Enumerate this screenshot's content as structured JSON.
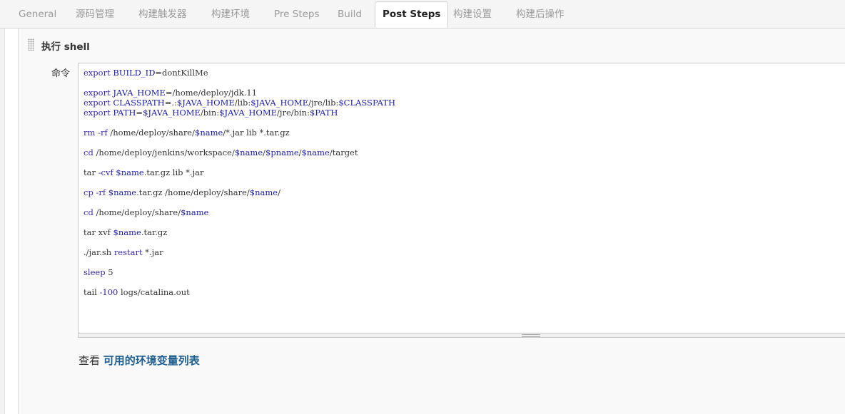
{
  "tabs": [
    {
      "label": "General"
    },
    {
      "label": "源码管理"
    },
    {
      "label": "构建触发器"
    },
    {
      "label": "构建环境"
    },
    {
      "label": "Pre Steps"
    },
    {
      "label": "Build"
    },
    {
      "label": "Post Steps",
      "active": true
    },
    {
      "label": "构建设置"
    },
    {
      "label": "构建后操作"
    }
  ],
  "section": {
    "title": "执行 shell",
    "command_label": "命令",
    "env_prefix": "查看",
    "env_link": "可用的环境变量列表"
  },
  "editor": {
    "value": "export BUILD_ID=dontKillMe\n\nexport JAVA_HOME=/home/deploy/jdk.11\nexport CLASSPATH=.:$JAVA_HOME/lib:$JAVA_HOME/jre/lib:$CLASSPATH\nexport PATH=$JAVA_HOME/bin:$JAVA_HOME/jre/bin:$PATH\n\nrm -rf /home/deploy/share/$name/*.jar lib *.tar.gz\n\ncd /home/deploy/jenkins/workspace/$name/$pname/$name/target\n\ntar -cvf $name.tar.gz lib *.jar\n\ncp -rf $name.tar.gz /home/deploy/share/$name/\n\ncd /home/deploy/share/$name\n\ntar xvf $name.tar.gz\n\n./jar.sh restart *.jar\n\nsleep 5\n\ntail -100 logs/catalina.out",
    "lines": [
      [
        {
          "t": "export",
          "c": "kw"
        },
        {
          "t": " "
        },
        {
          "t": "BUILD_ID",
          "c": "var"
        },
        {
          "t": "=dontKillMe"
        }
      ],
      [
        {
          "t": "export",
          "c": "kw"
        },
        {
          "t": " "
        },
        {
          "t": "JAVA_HOME",
          "c": "var"
        },
        {
          "t": "=/home/deploy/jdk.11"
        }
      ],
      [
        {
          "t": "export",
          "c": "kw"
        },
        {
          "t": " "
        },
        {
          "t": "CLASSPATH",
          "c": "var"
        },
        {
          "t": "=.:"
        },
        {
          "t": "$JAVA_HOME",
          "c": "var"
        },
        {
          "t": "/lib:"
        },
        {
          "t": "$JAVA_HOME",
          "c": "var"
        },
        {
          "t": "/jre/lib:"
        },
        {
          "t": "$CLASSPATH",
          "c": "var"
        }
      ],
      [
        {
          "t": "export",
          "c": "kw"
        },
        {
          "t": " "
        },
        {
          "t": "PATH",
          "c": "var"
        },
        {
          "t": "="
        },
        {
          "t": "$JAVA_HOME",
          "c": "var"
        },
        {
          "t": "/bin:"
        },
        {
          "t": "$JAVA_HOME",
          "c": "var"
        },
        {
          "t": "/jre/bin:"
        },
        {
          "t": "$PATH",
          "c": "var"
        }
      ],
      [
        {
          "t": "rm",
          "c": "kw"
        },
        {
          "t": " "
        },
        {
          "t": "-rf",
          "c": "kw"
        },
        {
          "t": " /home/deploy/share/"
        },
        {
          "t": "$name",
          "c": "var"
        },
        {
          "t": "/*.jar lib *.tar.gz"
        }
      ],
      [
        {
          "t": "cd",
          "c": "kw"
        },
        {
          "t": " /home/deploy/jenkins/workspace/"
        },
        {
          "t": "$name",
          "c": "var"
        },
        {
          "t": "/"
        },
        {
          "t": "$pname",
          "c": "var"
        },
        {
          "t": "/"
        },
        {
          "t": "$name",
          "c": "var"
        },
        {
          "t": "/target"
        }
      ],
      [
        {
          "t": "tar "
        },
        {
          "t": "-cvf",
          "c": "kw"
        },
        {
          "t": " "
        },
        {
          "t": "$name",
          "c": "var"
        },
        {
          "t": ".tar.gz lib *.jar"
        }
      ],
      [
        {
          "t": "cp",
          "c": "kw"
        },
        {
          "t": " "
        },
        {
          "t": "-rf",
          "c": "kw"
        },
        {
          "t": " "
        },
        {
          "t": "$name",
          "c": "var"
        },
        {
          "t": ".tar.gz /home/deploy/share/"
        },
        {
          "t": "$name",
          "c": "var"
        },
        {
          "t": "/"
        }
      ],
      [
        {
          "t": "cd",
          "c": "kw"
        },
        {
          "t": " /home/deploy/share/"
        },
        {
          "t": "$name",
          "c": "var"
        }
      ],
      [
        {
          "t": "tar xvf "
        },
        {
          "t": "$name",
          "c": "var"
        },
        {
          "t": ".tar.gz"
        }
      ],
      [
        {
          "t": "./jar.sh "
        },
        {
          "t": "restart",
          "c": "kw"
        },
        {
          "t": " *.jar"
        }
      ],
      [
        {
          "t": "sleep",
          "c": "kw"
        },
        {
          "t": " 5"
        }
      ],
      [
        {
          "t": "tail "
        },
        {
          "t": "-100",
          "c": "kw"
        },
        {
          "t": " logs/catalina.out"
        }
      ]
    ]
  },
  "colors": {
    "keyword": "#3a2bb0",
    "variable": "#1a1aa6",
    "link": "#1f5f8f"
  }
}
